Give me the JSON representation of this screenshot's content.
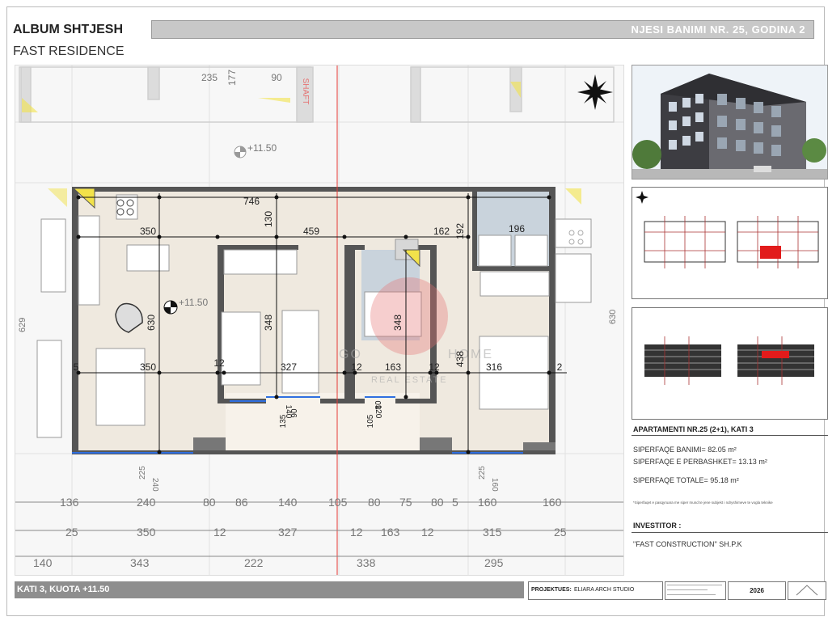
{
  "header": {
    "album_title": "ALBUM SHTJESH",
    "project_name": "FAST RESIDENCE",
    "unit_label": "NJESI BANIMI NR. 25, GODINA 2"
  },
  "plan": {
    "top_dims": [
      "235",
      "177",
      "90"
    ],
    "shaft_label": "SHAFT",
    "level_upper": "+11.50",
    "level_main": "+11.50",
    "inner_dims": {
      "w746": "746",
      "w350a": "350",
      "w459": "459",
      "h130": "130",
      "w162": "162",
      "h192": "192",
      "w196": "196",
      "h630a": "630",
      "h348a": "348",
      "h348b": "348",
      "h438": "438",
      "w350b": "350",
      "w12a": "12",
      "w327": "327",
      "w12b": "12",
      "w163": "163",
      "w12c": "12",
      "w316": "316",
      "w5": "5",
      "w2": "2",
      "h140": "140",
      "h90": "90",
      "h135": "135",
      "h120": "120",
      "h80": "80",
      "h105": "105",
      "side_left": "629",
      "side_right": "630",
      "b240": "240",
      "b225a": "225",
      "b160": "160",
      "b225b": "225"
    },
    "bottom_row1": [
      "136",
      "240",
      "80",
      "86",
      "140",
      "105",
      "80",
      "75",
      "80",
      "5",
      "160",
      "160"
    ],
    "bottom_row2": [
      "25",
      "350",
      "12",
      "327",
      "12",
      "163",
      "12",
      "315",
      "25"
    ],
    "bottom_row3": [
      "140",
      "343",
      "222",
      "338",
      "295"
    ],
    "watermark_go": "GO",
    "watermark_home": "HOME",
    "watermark_sub": "REAL ESTATE"
  },
  "info": {
    "apartment_title": "APARTAMENTI NR.25 (2+1), KATI 3",
    "area_living": "SIPERFAQE BANIMI=  82.05 m²",
    "area_common": "SIPERFAQE E PERBASHKET=  13.13 m²",
    "area_total": "SIPERFAQE TOTALE=  95.18 m²",
    "note": "*Siperfaqet e pasqyruara me siper mund te jene subjekt i ndryshimeve te vogla teknike",
    "investor_title": "INVESTITOR :",
    "investor_name": "\"FAST CONSTRUCTION\" SH.P.K"
  },
  "footer": {
    "floor_label": "KATI 3, KUOTA +11.50",
    "projektues_label": "PROJEKTUES:",
    "projektues_name": "ELIARA ARCH STUDIO",
    "year": "2026"
  },
  "colors": {
    "wall": "#555555",
    "floor": "#efe9df",
    "bath": "#c9d3dc",
    "red_axis": "#e53935",
    "highlight": "#e21b1b",
    "header_bar": "#c8c8c8",
    "footer_bar": "#8e8e8e"
  }
}
